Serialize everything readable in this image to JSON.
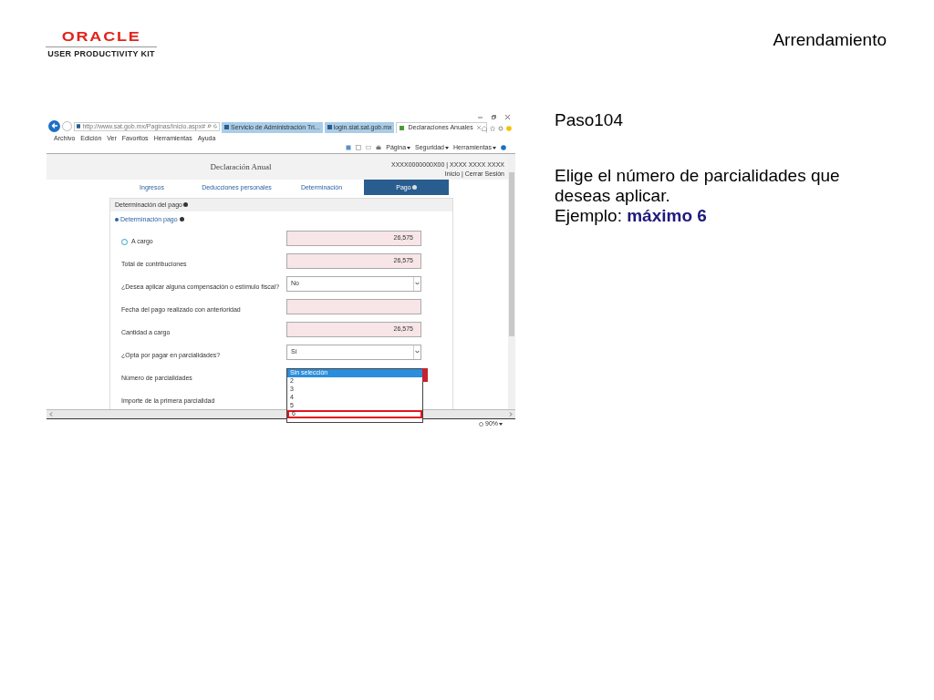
{
  "header": {
    "brand": "ORACLE",
    "product": "USER PRODUCTIVITY KIT",
    "title": "Arrendamiento"
  },
  "browser": {
    "address": "http://www.sat.gob.mx/Paginas/Inicio.aspx#",
    "tabs": [
      {
        "label": "Servicio de Administración Tri...",
        "selected": false
      },
      {
        "label": "login.siat.sat.gob.mx",
        "selected": false
      },
      {
        "label": "Declaraciones Anuales",
        "selected": true
      }
    ],
    "menu": [
      "Archivo",
      "Edición",
      "Ver",
      "Favoritos",
      "Herramientas",
      "Ayuda"
    ],
    "commands": [
      "Página",
      "Seguridad",
      "Herramientas"
    ],
    "zoom": "90%"
  },
  "page": {
    "title": "Declaración Anual",
    "account": "XXXX0000000X00 | XXXX XXXX XXXX",
    "user_links": "Inicio | Cerrar Sesión",
    "tabs": [
      {
        "label": "Ingresos",
        "selected": false
      },
      {
        "label": "Deducciones personales",
        "selected": false
      },
      {
        "label": "Determinación",
        "selected": false
      },
      {
        "label": "Pago",
        "selected": true
      }
    ],
    "panel_title": "Determinación del pago",
    "section_title": "Determinación pago",
    "fields": [
      {
        "label": "A cargo",
        "kind": "text",
        "value": "26,575",
        "help": true
      },
      {
        "label": "Total de contribuciones",
        "kind": "text",
        "value": "26,575"
      },
      {
        "label": "¿Desea aplicar alguna compensación o estímulo fiscal?",
        "kind": "select",
        "value": "No"
      },
      {
        "label": "Fecha del pago realizado con anterioridad",
        "kind": "text"
      },
      {
        "label": "Cantidad a cargo",
        "kind": "text",
        "value": "26,575"
      },
      {
        "label": "¿Opta por pagar en parcialidades?",
        "kind": "select",
        "value": "Sí"
      },
      {
        "label": "Número de parcialidades",
        "kind": "list",
        "error": true,
        "options": [
          {
            "label": "Sin selección",
            "selected": true,
            "highlighted": false
          },
          {
            "label": "2",
            "selected": false,
            "highlighted": false
          },
          {
            "label": "3",
            "selected": false,
            "highlighted": false
          },
          {
            "label": "4",
            "selected": false,
            "highlighted": false
          },
          {
            "label": "5",
            "selected": false,
            "highlighted": false
          },
          {
            "label": "6",
            "selected": false,
            "highlighted": true
          }
        ]
      },
      {
        "label": "Importe de la primera parcialidad",
        "kind": "hidden"
      }
    ]
  },
  "step": {
    "title": "Paso104",
    "instruction": "Elige el número de parcialidades que deseas aplicar.",
    "example": "Ejemplo: **máximo 6**"
  }
}
